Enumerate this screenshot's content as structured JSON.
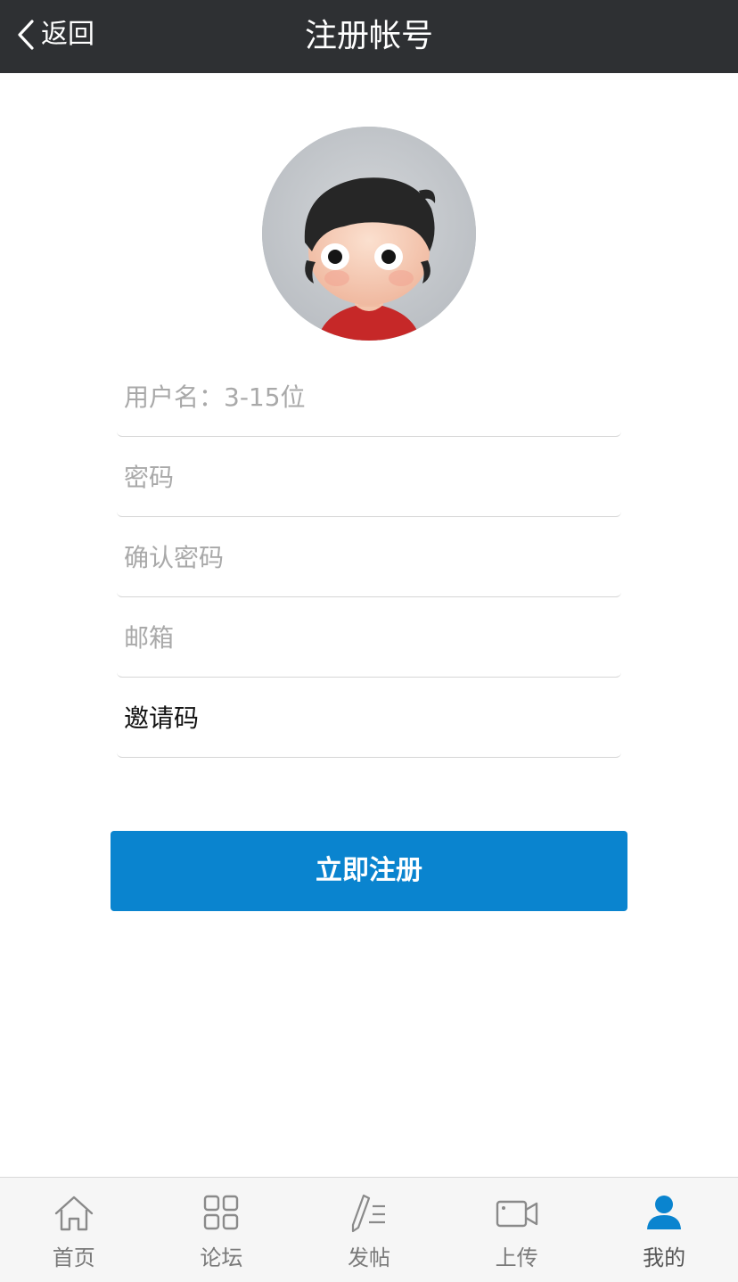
{
  "header": {
    "back_label": "返回",
    "title": "注册帐号",
    "background": "#2e3033"
  },
  "avatar": {
    "icon": "default-avatar-cartoon-boy"
  },
  "form": {
    "username_placeholder": "用户名：3-15位",
    "password_placeholder": "密码",
    "confirm_password_placeholder": "确认密码",
    "email_placeholder": "邮箱",
    "invite_code_placeholder": "邀请码",
    "submit_label": "立即注册",
    "submit_color": "#0a84cf"
  },
  "tabbar": {
    "items": [
      {
        "label": "首页",
        "icon": "home-icon"
      },
      {
        "label": "论坛",
        "icon": "grid-icon"
      },
      {
        "label": "发帖",
        "icon": "compose-icon"
      },
      {
        "label": "上传",
        "icon": "video-camera-icon"
      },
      {
        "label": "我的",
        "icon": "user-icon",
        "active": true
      }
    ],
    "active_color": "#0a84cf"
  }
}
